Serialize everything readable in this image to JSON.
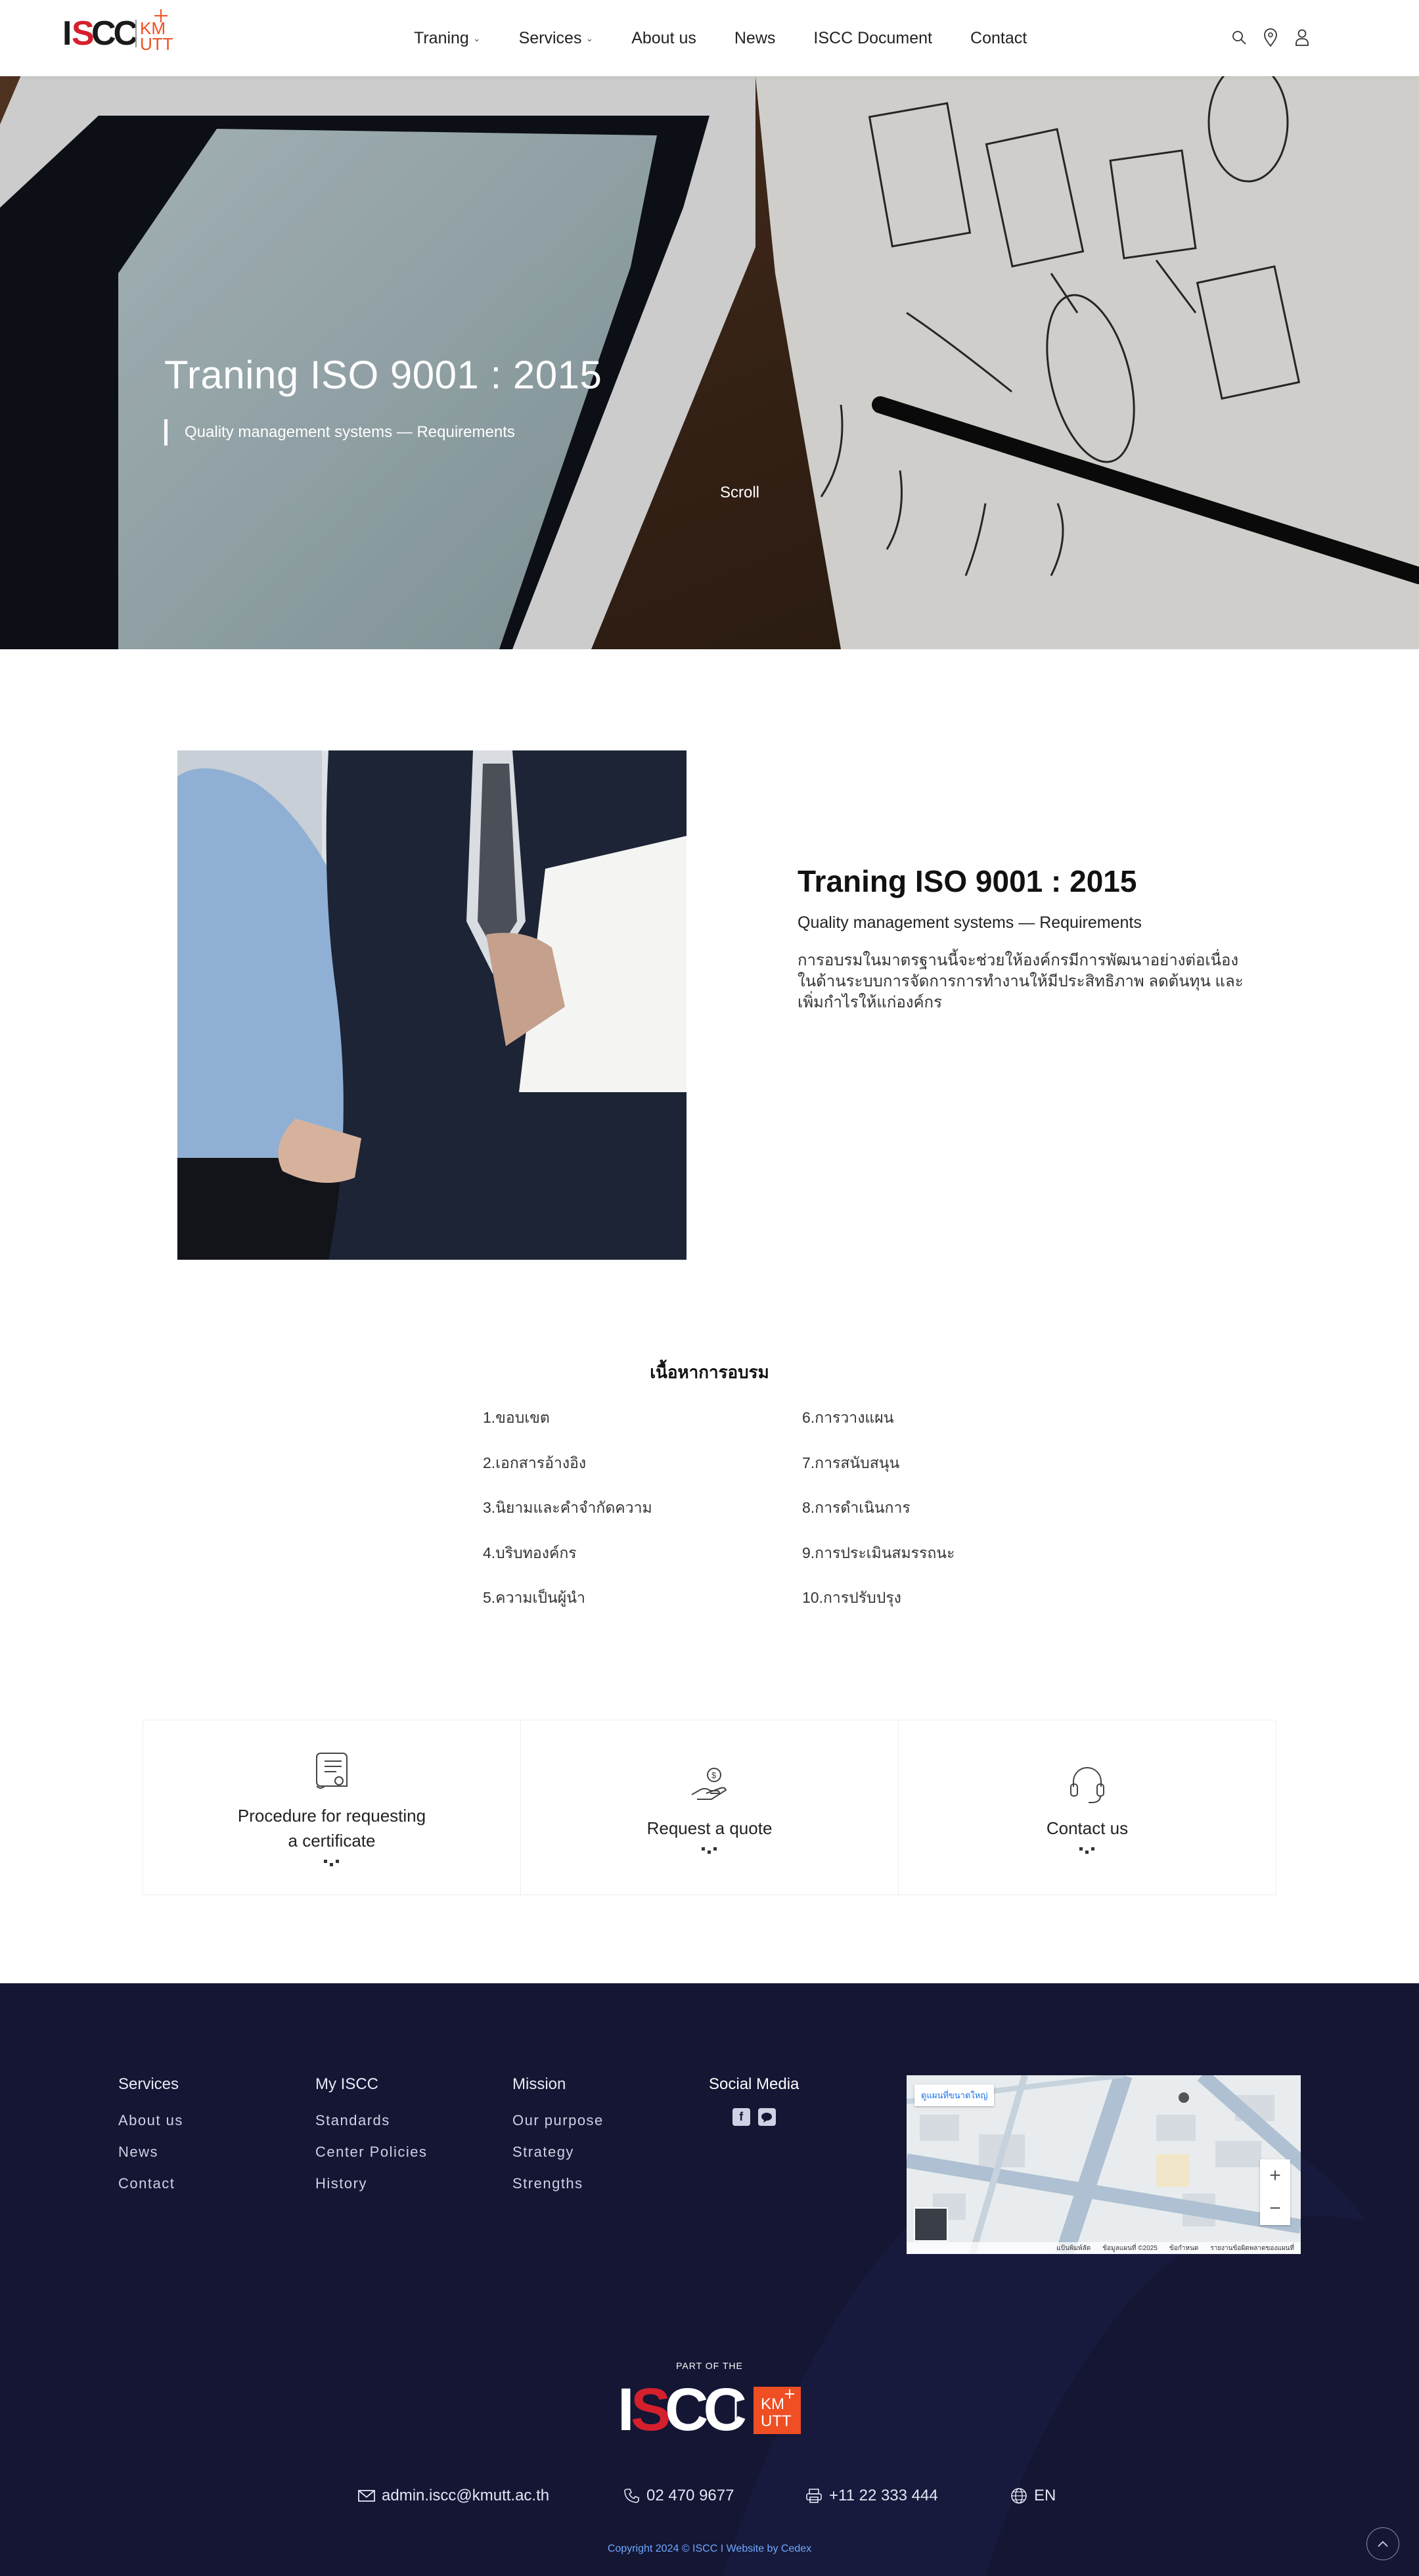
{
  "header": {
    "nav": [
      {
        "label": "Traning",
        "has_dropdown": true
      },
      {
        "label": "Services",
        "has_dropdown": true
      },
      {
        "label": "About us",
        "has_dropdown": false
      },
      {
        "label": "News",
        "has_dropdown": false
      },
      {
        "label": "ISCC Document",
        "has_dropdown": false
      },
      {
        "label": "Contact",
        "has_dropdown": false
      }
    ],
    "icons": [
      "search-icon",
      "location-pin-icon",
      "user-icon"
    ],
    "logo_text": "ISCC",
    "kmutt_text": "KM UTT"
  },
  "hero": {
    "title": "Traning ISO 9001 : 2015",
    "subtitle": "Quality management systems — Requirements",
    "scroll_label": "Scroll"
  },
  "intro": {
    "title": "Traning ISO 9001 : 2015",
    "subtitle": "Quality management systems — Requirements",
    "description": "การอบรมในมาตรฐานนี้จะช่วยให้องค์กรมีการพัฒนาอย่างต่อเนื่องในด้านระบบการจัดการการทำงานให้มีประสิทธิภาพ ลดต้นทุน และเพิ่มกำไรให้แก่องค์กร"
  },
  "contents": {
    "title": "เนื้อหาการอบรม",
    "left": [
      "1.ขอบเขต",
      "2.เอกสารอ้างอิง",
      "3.นิยามและคำจำกัดความ",
      "4.บริบทองค์กร",
      "5.ความเป็นผู้นำ"
    ],
    "right": [
      "6.การวางแผน",
      "7.การสนับสนุน",
      "8.การดำเนินการ",
      "9.การประเมินสมรรถนะ",
      "10.การปรับปรุง"
    ]
  },
  "cards": [
    {
      "label": "Procedure for requesting a certificate",
      "icon": "certificate-scroll-icon"
    },
    {
      "label": "Request a quote",
      "icon": "hand-coin-icon"
    },
    {
      "label": "Contact us",
      "icon": "headset-icon"
    }
  ],
  "footer": {
    "col1": {
      "head": "Services",
      "links": [
        "About us",
        "News",
        "Contact"
      ]
    },
    "col2": {
      "head": "My ISCC",
      "links": [
        "Standards",
        "Center Policies",
        "History"
      ]
    },
    "col3": {
      "head": "Mission",
      "links": [
        "Our purpose",
        "Strategy",
        "Strengths"
      ]
    },
    "social": {
      "head": "Social Media",
      "icons": [
        "facebook-icon",
        "line-icon"
      ]
    },
    "map": {
      "tag": "ดูแผนที่ขนาดใหญ่",
      "zoom_in": "+",
      "zoom_out": "−",
      "footer_items": [
        "แป้นพิมพ์ลัด",
        "ข้อมูลแผนที่ ©2025",
        "ข้อกำหนด",
        "รายงานข้อผิดพลาดของแผนที่"
      ]
    },
    "part_of": "PART OF THE",
    "email": "admin.iscc@kmutt.ac.th",
    "phone": "02 470 9677",
    "fax": "+11 22 333 444",
    "language": "EN",
    "copyright": "Copyright 2024 © ISCC I Website by Cedex"
  },
  "colors": {
    "footer_bg": "#141634",
    "brand_red": "#d4202c",
    "kmutt_orange": "#f04e23",
    "link_blue": "#6fa8ff"
  }
}
